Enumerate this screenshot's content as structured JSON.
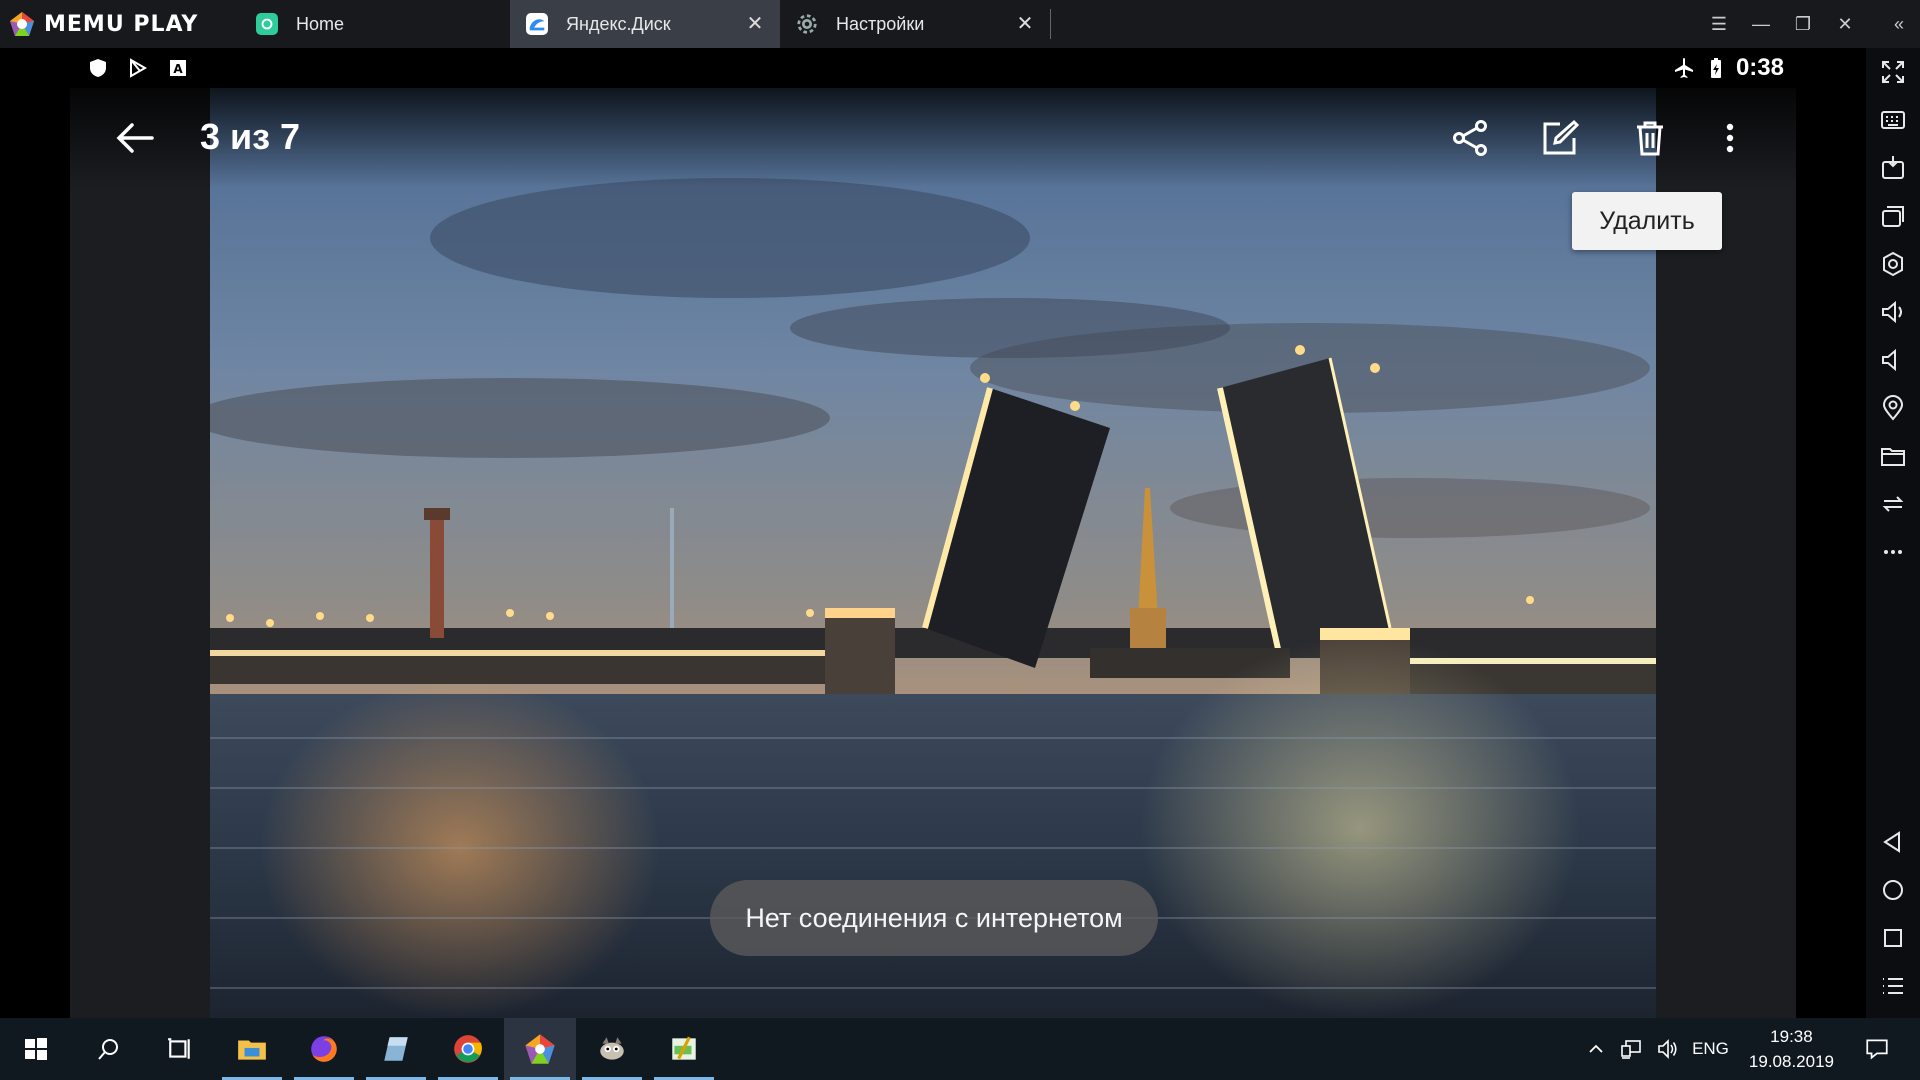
{
  "emulator": {
    "brand": "MEMU PLAY",
    "tabs": [
      {
        "label": "Home"
      },
      {
        "label": "Яндекс.Диск"
      },
      {
        "label": "Настройки"
      }
    ]
  },
  "android": {
    "status": {
      "time": "0:38"
    },
    "viewer": {
      "counter": "3 из 7",
      "tooltip": "Удалить",
      "toast": "Нет соединения с интернетом"
    }
  },
  "taskbar": {
    "language": "ENG",
    "time": "19:38",
    "date": "19.08.2019"
  },
  "colors": {
    "titlebar": "#17191d",
    "active_tab": "#3a3f47",
    "taskbar": "#101820",
    "accent": "#79b8e8"
  }
}
